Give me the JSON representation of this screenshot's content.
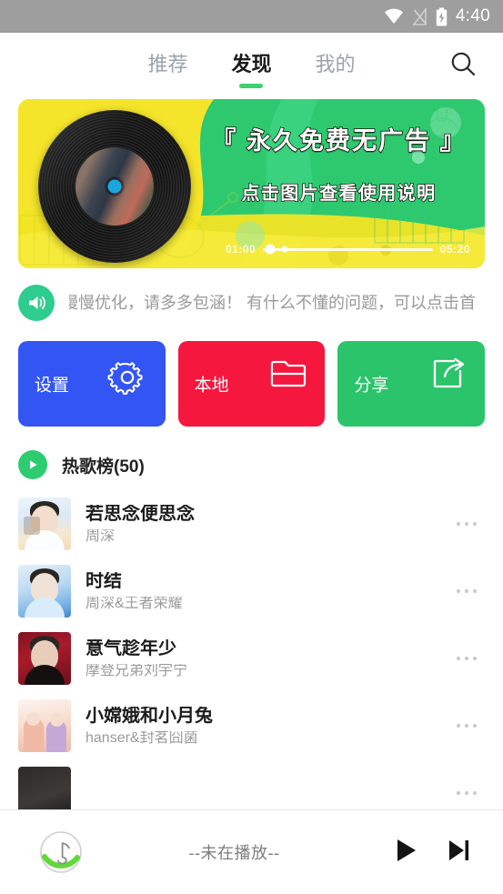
{
  "status_bar": {
    "time": "4:40",
    "icons": [
      "wifi-icon",
      "signal-off-icon",
      "battery-charging-icon"
    ]
  },
  "topbar": {
    "tabs": [
      {
        "label": "推荐",
        "active": false
      },
      {
        "label": "发现",
        "active": true
      },
      {
        "label": "我的",
        "active": false
      }
    ],
    "search_icon": "search-icon"
  },
  "banner": {
    "title": "『 永久免费无广告 』",
    "subtitle": "点击图片查看使用说明",
    "current_time": "01:00",
    "total_time": "05:20",
    "progress_percent": 4,
    "marker_percent": 13,
    "colors": {
      "yellow": "#f5e52a",
      "green": "#2ecc71"
    }
  },
  "notice": {
    "icon": "speaker-icon",
    "text": "慢慢优化，请多多包涵！  有什么不懂的问题，可以点击首"
  },
  "cards": [
    {
      "label": "设置",
      "icon": "gear-icon",
      "color": "#3355f3"
    },
    {
      "label": "本地",
      "icon": "folder-icon",
      "color": "#f5173e"
    },
    {
      "label": "分享",
      "icon": "share-icon",
      "color": "#2bc46b"
    }
  ],
  "rank": {
    "play_icon": "play-icon",
    "title": "热歌榜(50)"
  },
  "songs": [
    {
      "name": "若思念便思念",
      "artist": "周深",
      "cover": "cv1"
    },
    {
      "name": "时结",
      "artist": "周深&王者荣耀",
      "cover": "cv2"
    },
    {
      "name": "意气趁年少",
      "artist": "摩登兄弟刘宇宁",
      "cover": "cv3"
    },
    {
      "name": "小嫦娥和小月兔",
      "artist": "hanser&封茗囧菌",
      "cover": "cv4"
    },
    {
      "name": "",
      "artist": "",
      "cover": "cv5"
    }
  ],
  "player": {
    "logo_icon": "music-note-logo",
    "status": "--未在播放--",
    "play_icon": "play-icon",
    "next_icon": "next-track-icon"
  }
}
